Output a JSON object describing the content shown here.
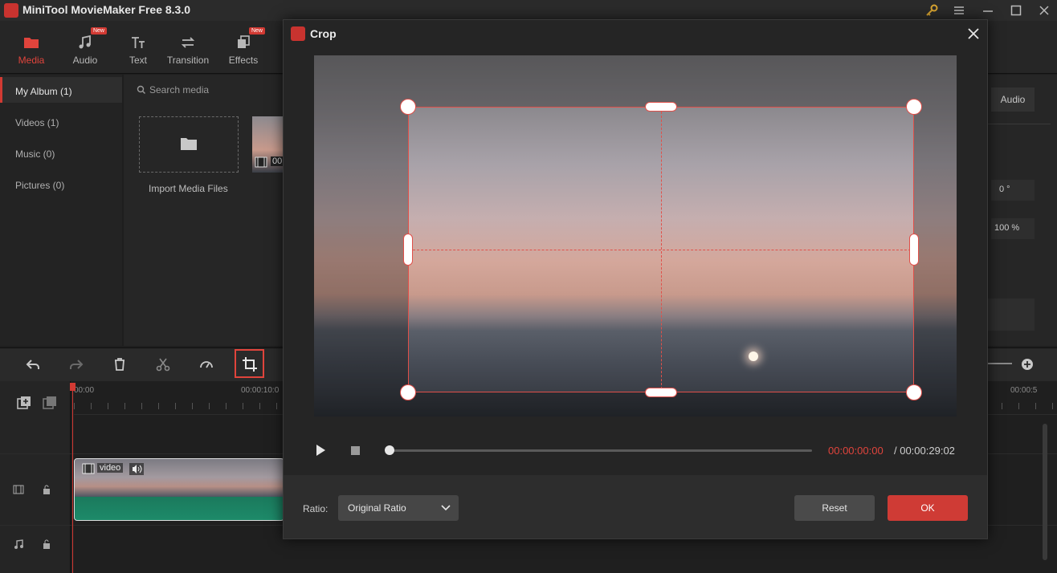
{
  "app": {
    "title": "MiniTool MovieMaker Free 8.3.0"
  },
  "toolbar": {
    "media": "Media",
    "audio": "Audio",
    "text": "Text",
    "transition": "Transition",
    "effects": "Effects",
    "new_badge": "New"
  },
  "sidebar": {
    "items": [
      {
        "label": "My Album (1)"
      },
      {
        "label": "Videos (1)"
      },
      {
        "label": "Music (0)"
      },
      {
        "label": "Pictures (0)"
      }
    ]
  },
  "media": {
    "search_placeholder": "Search media",
    "import_label": "Import Media Files",
    "thumb_duration": "00"
  },
  "right_panel": {
    "audio_tab": "Audio",
    "rotation": "0 °",
    "scale": "100 %"
  },
  "timeline": {
    "time_0": "00:00",
    "time_1": "00:00:10:0",
    "time_end": "00:00:5",
    "clip_label": "video"
  },
  "dialog": {
    "title": "Crop",
    "time_current": "00:00:00:00",
    "time_total": "/ 00:00:29:02",
    "ratio_label": "Ratio:",
    "ratio_value": "Original Ratio",
    "reset_label": "Reset",
    "ok_label": "OK"
  },
  "colors": {
    "accent": "#d23a33",
    "crop_line": "#e0504a"
  }
}
